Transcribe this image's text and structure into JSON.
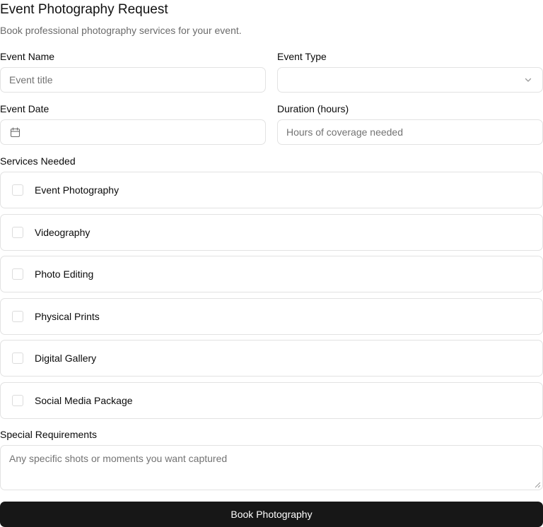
{
  "form": {
    "title": "Event Photography Request",
    "subtitle": "Book professional photography services for your event."
  },
  "fields": {
    "event_name": {
      "label": "Event Name",
      "placeholder": "Event title",
      "value": ""
    },
    "event_type": {
      "label": "Event Type",
      "value": ""
    },
    "event_date": {
      "label": "Event Date",
      "value": ""
    },
    "duration": {
      "label": "Duration (hours)",
      "placeholder": "Hours of coverage needed",
      "value": ""
    }
  },
  "services": {
    "label": "Services Needed",
    "items": [
      {
        "label": "Event Photography",
        "checked": false
      },
      {
        "label": "Videography",
        "checked": false
      },
      {
        "label": "Photo Editing",
        "checked": false
      },
      {
        "label": "Physical Prints",
        "checked": false
      },
      {
        "label": "Digital Gallery",
        "checked": false
      },
      {
        "label": "Social Media Package",
        "checked": false
      }
    ]
  },
  "special_requirements": {
    "label": "Special Requirements",
    "placeholder": "Any specific shots or moments you want captured",
    "value": ""
  },
  "submit": {
    "label": "Book Photography"
  },
  "icons": {
    "event_type": "chevron-down-icon",
    "event_date": "calendar-icon",
    "textarea": "resize-grip-icon"
  },
  "colors": {
    "button_bg": "#171717",
    "border": "#e2e2e2",
    "muted_text": "#737373"
  }
}
